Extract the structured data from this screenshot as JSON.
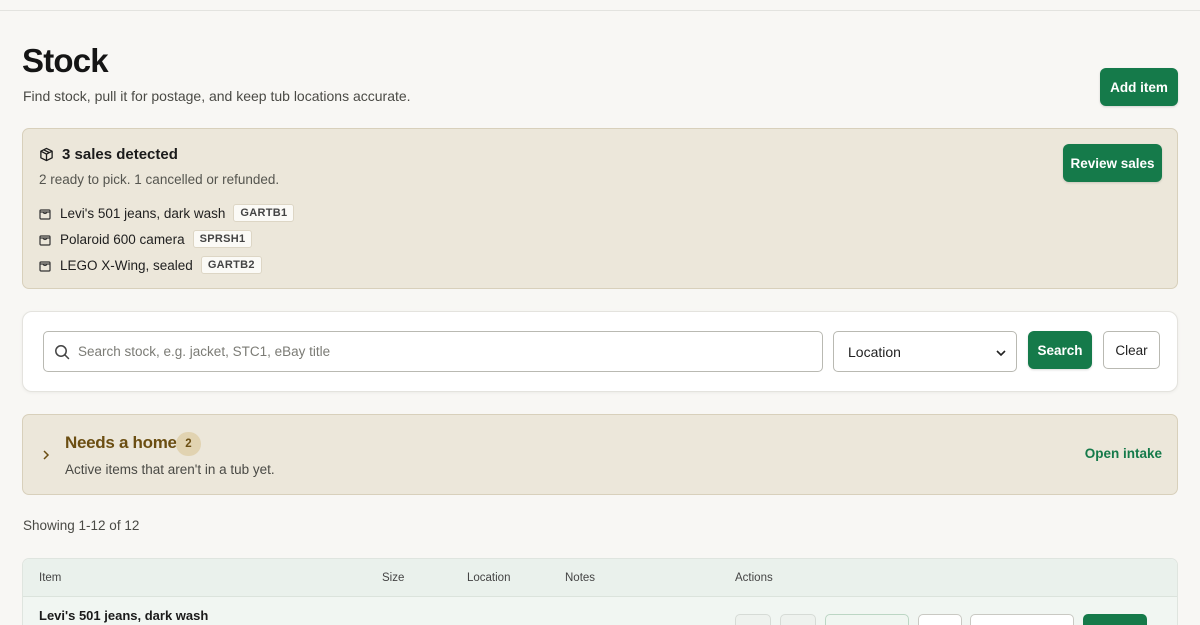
{
  "header": {
    "title": "Stock",
    "subtitle": "Find stock, pull it for postage, and keep tub locations accurate.",
    "add_item_label": "Add item"
  },
  "sales": {
    "title": "3 sales detected",
    "summary": "2 ready to pick. 1 cancelled or refunded.",
    "review_label": "Review sales",
    "items": [
      {
        "name": "Levi's 501 jeans, dark wash",
        "sku": "GARTB1"
      },
      {
        "name": "Polaroid 600 camera",
        "sku": "SPRSH1"
      },
      {
        "name": "LEGO X-Wing, sealed",
        "sku": "GARTB2"
      }
    ]
  },
  "search": {
    "placeholder": "Search stock, e.g. jacket, STC1, eBay title",
    "location_selected": "Location",
    "search_label": "Search",
    "clear_label": "Clear"
  },
  "needs_home": {
    "title": "Needs a home",
    "count": "2",
    "subtitle": "Active items that aren't in a tub yet.",
    "open_intake_label": "Open intake"
  },
  "results": {
    "showing": "Showing 1-12 of 12"
  },
  "table": {
    "columns": [
      "Item",
      "Size",
      "Location",
      "Notes",
      "Actions"
    ],
    "rows": [
      {
        "item": "Levi's 501 jeans, dark wash"
      }
    ]
  },
  "colors": {
    "accent": "#157a4a",
    "panel": "#ece7da",
    "needs_home_text": "#6b4e12"
  }
}
